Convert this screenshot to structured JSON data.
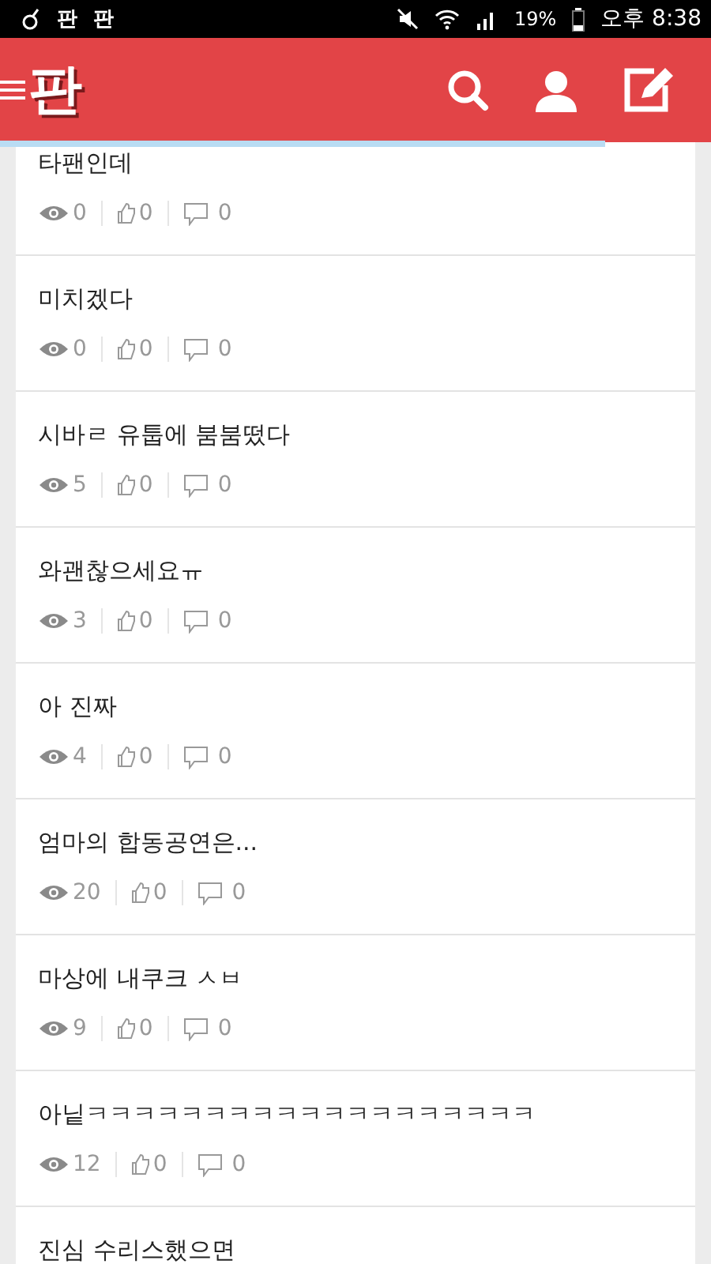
{
  "status_bar": {
    "notification_apps": [
      "판",
      "판"
    ],
    "battery": "19%",
    "time": "오후 8:38"
  },
  "header": {
    "logo": "판",
    "loading": {
      "level": 0.85
    }
  },
  "posts": [
    {
      "title": "타팬인데",
      "views": "0",
      "likes": "0",
      "comments": "0"
    },
    {
      "title": "미치겠다",
      "views": "0",
      "likes": "0",
      "comments": "0"
    },
    {
      "title": "시바ㄹ 유툽에 붐붐떴다",
      "views": "5",
      "likes": "0",
      "comments": "0"
    },
    {
      "title": "와괜찮으세요ㅠ",
      "views": "3",
      "likes": "0",
      "comments": "0"
    },
    {
      "title": "아 진짜",
      "views": "4",
      "likes": "0",
      "comments": "0"
    },
    {
      "title": "엄마의 합동공연은...",
      "views": "20",
      "likes": "0",
      "comments": "0"
    },
    {
      "title": "마상에 내쿠크 ㅅㅂ",
      "views": "9",
      "likes": "0",
      "comments": "0"
    },
    {
      "title": "아닡ㅋㅋㅋㅋㅋㅋㅋㅋㅋㅋㅋㅋㅋㅋㅋㅋㅋㅋㅋ",
      "views": "12",
      "likes": "0",
      "comments": "0"
    },
    {
      "title": "진심 수리스했으면"
    }
  ]
}
